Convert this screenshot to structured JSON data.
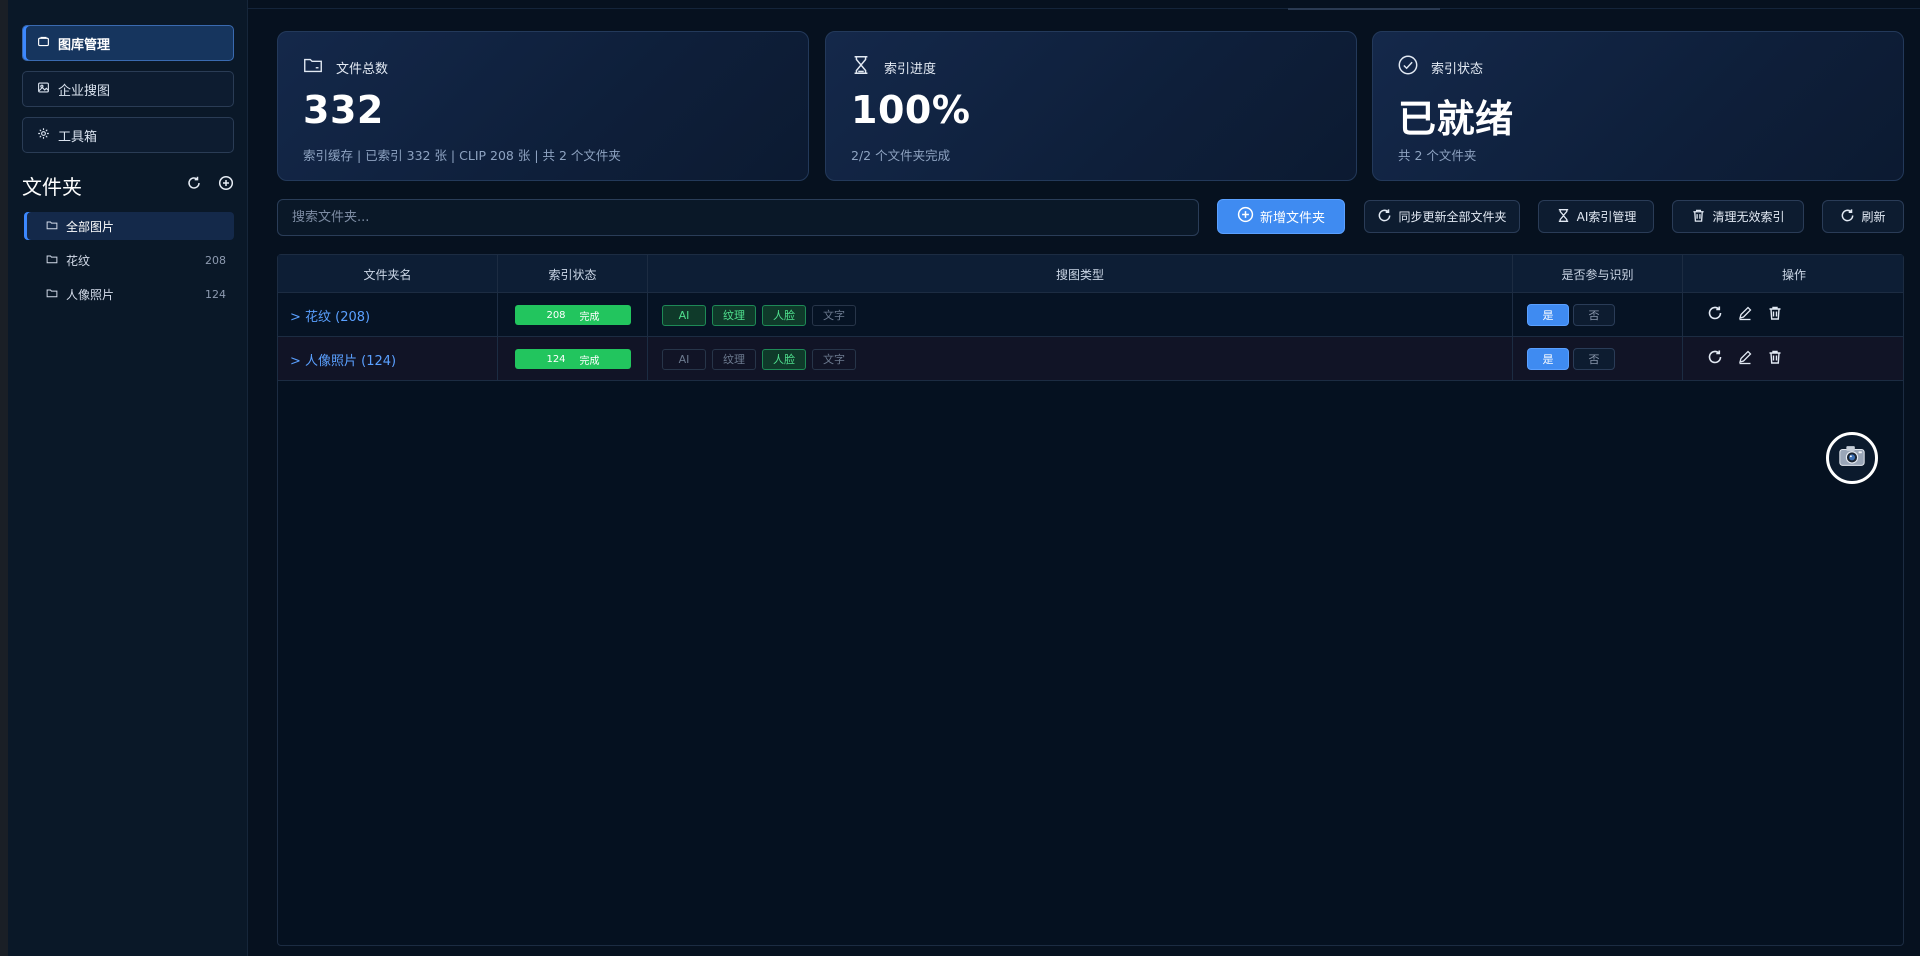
{
  "sidebar": {
    "nav": [
      {
        "label": "图库管理",
        "icon": "library-icon",
        "active": true
      },
      {
        "label": "企业搜图",
        "icon": "image-icon",
        "active": false
      },
      {
        "label": "工具箱",
        "icon": "gear-icon",
        "active": false
      }
    ],
    "folders_title": "文件夹",
    "folders": [
      {
        "label": "全部图片",
        "count": "",
        "active": true
      },
      {
        "label": "花纹",
        "count": "208",
        "active": false
      },
      {
        "label": "人像照片",
        "count": "124",
        "active": false
      }
    ]
  },
  "stats": [
    {
      "title": "文件总数",
      "value": "332",
      "sub": "索引缓存 | 已索引 332 张 | CLIP 208 张 | 共 2 个文件夹",
      "icon": "folder-icon"
    },
    {
      "title": "索引进度",
      "value": "100%",
      "sub": "2/2 个文件夹完成",
      "icon": "hourglass-icon"
    },
    {
      "title": "索引状态",
      "value": "已就绪",
      "sub": "共 2 个文件夹",
      "icon": "check-circle-icon"
    }
  ],
  "toolbar": {
    "search_placeholder": "搜索文件夹...",
    "add_folder": "新增文件夹",
    "sync_all": "同步更新全部文件夹",
    "ai_index": "AI索引管理",
    "clean_index": "清理无效索引",
    "refresh": "刷新"
  },
  "table": {
    "headers": [
      "文件夹名",
      "索引状态",
      "搜图类型",
      "是否参与识别",
      "操作"
    ],
    "rows": [
      {
        "name": "> 花纹 (208)",
        "status_count": "208",
        "status_label": "完成",
        "tags": [
          {
            "label": "AI",
            "on": true
          },
          {
            "label": "纹理",
            "on": true
          },
          {
            "label": "人脸",
            "on": true
          },
          {
            "label": "文字",
            "on": false
          }
        ],
        "yes": "是",
        "no": "否"
      },
      {
        "name": "> 人像照片 (124)",
        "status_count": "124",
        "status_label": "完成",
        "tags": [
          {
            "label": "AI",
            "on": false
          },
          {
            "label": "纹理",
            "on": false
          },
          {
            "label": "人脸",
            "on": true
          },
          {
            "label": "文字",
            "on": false
          }
        ],
        "yes": "是",
        "no": "否"
      }
    ]
  },
  "colors": {
    "accent": "#3f8bf1",
    "success": "#22c55e",
    "background": "#06111f"
  }
}
